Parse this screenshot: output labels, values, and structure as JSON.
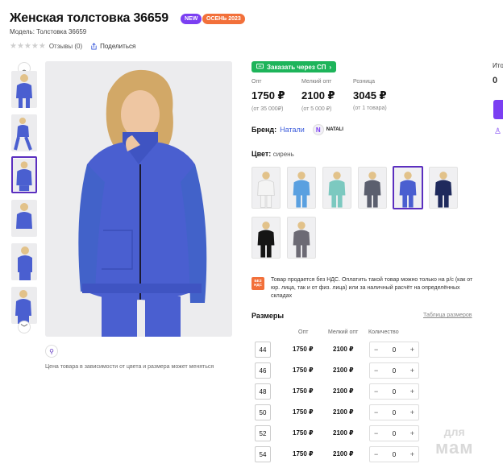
{
  "product": {
    "title": "Женская толстовка 36659",
    "badge_new": "NEW",
    "badge_season": "ОСЕНЬ 2023",
    "models": "Модель: Толстовка 36659",
    "reviews": "Отзывы (0)",
    "share": "Поделиться",
    "color_note": "Цена товара в зависимости от цвета и размера может меняться"
  },
  "order": {
    "sp_button": "Заказать через СП"
  },
  "prices": [
    {
      "label": "Опт",
      "value": "1750 ₽",
      "sub": "(от 35 000₽)"
    },
    {
      "label": "Мелкий опт",
      "value": "2100 ₽",
      "sub": "(от 5 000 ₽)"
    },
    {
      "label": "Розница",
      "value": "3045 ₽",
      "sub": "(от 1 товара)"
    }
  ],
  "brand": {
    "label": "Бренд:",
    "value": "Натали",
    "logo_text": "NATALI",
    "logo_letter": "N"
  },
  "color": {
    "label": "Цвет:",
    "value": "сирень"
  },
  "vat": {
    "icon_text_1": "БЕЗ",
    "icon_text_2": "НДС",
    "text": "Товар продается без НДС. Оплатить такой товар можно только на р/с (как от юр. лица, так и от физ. лица) или за наличный расчёт на определённых складах"
  },
  "sizes": {
    "title": "Размеры",
    "table_link": "Таблица размеров",
    "headers": {
      "opt": "Опт",
      "small_opt": "Мелкий опт",
      "qty": "Количество"
    },
    "rows": [
      {
        "size": "44",
        "opt": "1750 ₽",
        "small_opt": "2100 ₽",
        "qty": "0"
      },
      {
        "size": "46",
        "opt": "1750 ₽",
        "small_opt": "2100 ₽",
        "qty": "0"
      },
      {
        "size": "48",
        "opt": "1750 ₽",
        "small_opt": "2100 ₽",
        "qty": "0"
      },
      {
        "size": "50",
        "opt": "1750 ₽",
        "small_opt": "2100 ₽",
        "qty": "0"
      },
      {
        "size": "52",
        "opt": "1750 ₽",
        "small_opt": "2100 ₽",
        "qty": "0"
      },
      {
        "size": "54",
        "opt": "1750 ₽",
        "small_opt": "2100 ₽",
        "qty": "0"
      }
    ]
  },
  "edge": {
    "text_1": "Ито",
    "text_2": "0"
  },
  "watermark": {
    "line1": "для",
    "line2": "мам"
  },
  "colors": {
    "accent": "#7b3ff2",
    "green": "#1db45a",
    "orange": "#f2703a",
    "hoodie": "#4a5fd0"
  },
  "swatch_colors": [
    "#f4f4f4",
    "#5aa0e0",
    "#7cc9c0",
    "#5b5f6e",
    "#4a5fd0",
    "#1f2a5c",
    "#151515",
    "#6c6a74"
  ]
}
